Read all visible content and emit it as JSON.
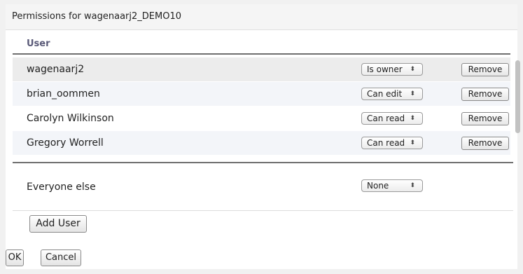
{
  "dialog": {
    "title": "Permissions for wagenaarj2_DEMO10"
  },
  "table": {
    "header": "User"
  },
  "users": [
    {
      "name": "wagenaarj2",
      "permission": "Is owner",
      "remove_label": "Remove"
    },
    {
      "name": "brian_oommen",
      "permission": "Can edit",
      "remove_label": "Remove"
    },
    {
      "name": "Carolyn Wilkinson",
      "permission": "Can read",
      "remove_label": "Remove"
    },
    {
      "name": "Gregory Worrell",
      "permission": "Can read",
      "remove_label": "Remove"
    }
  ],
  "everyone_else": {
    "label": "Everyone else",
    "permission": "None"
  },
  "buttons": {
    "add_user": "Add User",
    "ok": "OK",
    "cancel": "Cancel"
  },
  "icons": {
    "select_arrows": "⇕",
    "select_arrow_glyph": "updown-arrows-icon"
  },
  "colors": {
    "header_text": "#5a5a78",
    "row_shade": "#f3f5f9",
    "selected_row": "#ececec"
  }
}
